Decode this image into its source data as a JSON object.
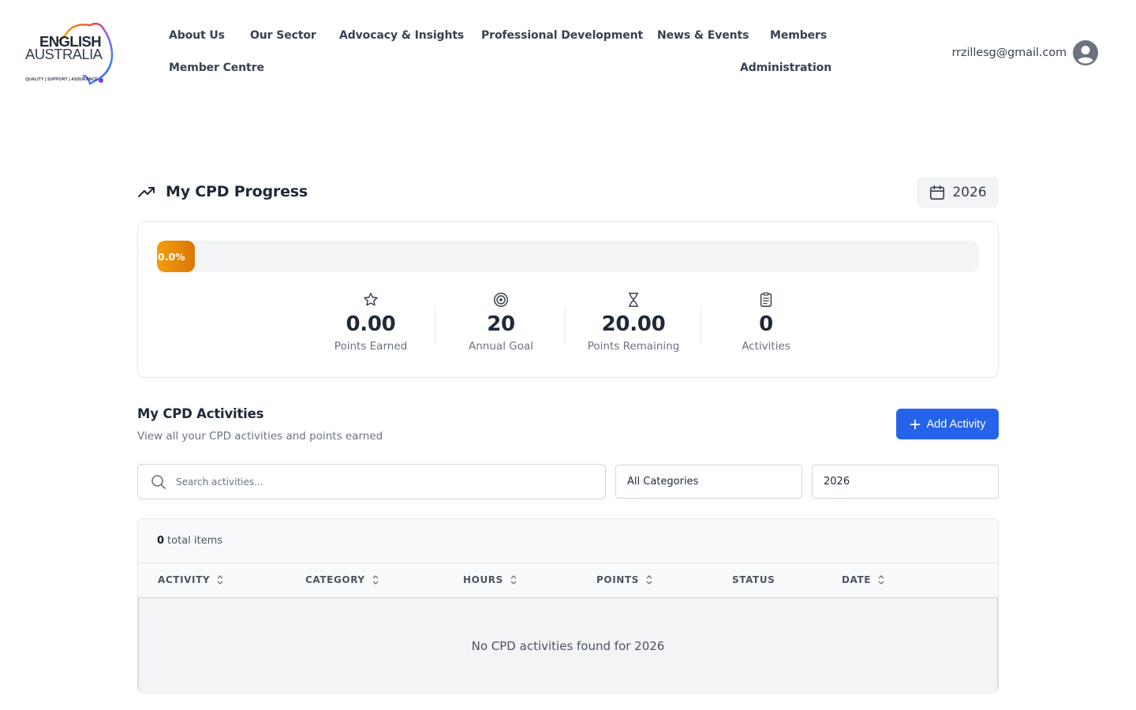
{
  "logo": {
    "line1": "ENGLISH",
    "line2": "AUSTRALIA",
    "tagline": "QUALITY | SUPPORT | ASSURANCE"
  },
  "nav": {
    "items": [
      {
        "label": "About Us"
      },
      {
        "label": "Our Sector"
      },
      {
        "label": "Advocacy & Insights"
      },
      {
        "label": "Professional Development"
      },
      {
        "label": "News & Events"
      },
      {
        "label": "Members"
      },
      {
        "label": "Member Centre"
      },
      {
        "label": "Administration"
      }
    ]
  },
  "user": {
    "email": "rrzillesg@gmail.com",
    "avatar_icon": "user-circle-icon"
  },
  "progress": {
    "title": "My CPD Progress",
    "title_icon": "trending-up-icon",
    "year": "2026",
    "year_icon": "calendar-icon",
    "percent": 0.0,
    "percent_label": "0.0%",
    "bar_color": "#e98a0c",
    "stats": [
      {
        "icon": "star-icon",
        "value": "0.00",
        "label": "Points Earned"
      },
      {
        "icon": "target-icon",
        "value": "20",
        "label": "Annual Goal"
      },
      {
        "icon": "hourglass-icon",
        "value": "20.00",
        "label": "Points Remaining"
      },
      {
        "icon": "clipboard-icon",
        "value": "0",
        "label": "Activities"
      }
    ]
  },
  "activities": {
    "title": "My CPD Activities",
    "subtitle": "View all your CPD activities and points earned",
    "add_button": "Add Activity",
    "accent": "#2563eb",
    "search_placeholder": "Search activities...",
    "category_select": "All Categories",
    "year_select": "2026",
    "total_count": "0",
    "total_label": "total items",
    "columns": [
      {
        "label": "ACTIVITY",
        "sortable": true
      },
      {
        "label": "CATEGORY",
        "sortable": true
      },
      {
        "label": "HOURS",
        "sortable": true
      },
      {
        "label": "POINTS",
        "sortable": true
      },
      {
        "label": "STATUS",
        "sortable": false
      },
      {
        "label": "DATE",
        "sortable": true
      }
    ],
    "empty_message": "No CPD activities found for 2026"
  }
}
